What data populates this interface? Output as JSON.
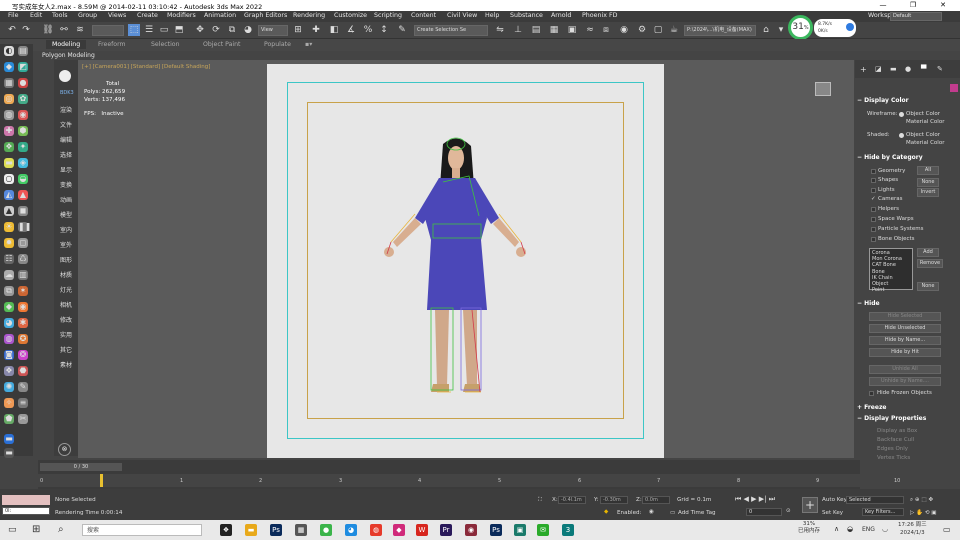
{
  "window": {
    "title": "写实成年女人2.max - 8.59M @ 2014-02-11 03:10:42 - Autodesk 3ds Max 2022",
    "min": "—",
    "max": "❐",
    "close": "✕"
  },
  "menu": [
    "File",
    "Edit",
    "Tools",
    "Group",
    "Views",
    "Create",
    "Modifiers",
    "Animation",
    "Graph Editors",
    "Rendering",
    "Customize",
    "Scripting",
    "Content",
    "Civil View",
    "Help",
    "Substance",
    "Arnold",
    "Phoenix FD"
  ],
  "workspace": {
    "label": "Workspaces:",
    "value": "Default"
  },
  "toolbar": {
    "view_dropdown": "View",
    "selection_set": "Create Selection Se",
    "project_path": "P:\\2024\\...\\机电_设备(MAX)",
    "memory_percent": "31",
    "memory_unit": "%",
    "net_up": "8.7K/s",
    "net_down": "0K/s"
  },
  "ribbon": {
    "tabs": [
      "Modeling",
      "Freeform",
      "Selection",
      "Object Paint",
      "Populate"
    ],
    "active": "Modeling",
    "sub": "Polygon Modeling"
  },
  "cn_panel": [
    "BDK3",
    "渲染",
    "文件",
    "编辑",
    "选择",
    "显示",
    "变换",
    "动画",
    "模型",
    "室内",
    "室外",
    "图形",
    "材质",
    "灯光",
    "相机",
    "修改",
    "实用",
    "其它",
    "素材"
  ],
  "viewport": {
    "label_parts": [
      "[+]",
      "[Camera001]",
      "[Standard]",
      "[Default Shading]"
    ],
    "stats": {
      "total": "Total",
      "polys_label": "Polys:",
      "polys": "262,659",
      "verts_label": "Verts:",
      "verts": "137,496",
      "fps_label": "FPS:",
      "fps": "Inactive"
    }
  },
  "right_panel": {
    "display_color": {
      "title": "Display Color",
      "wireframe": "Wireframe:",
      "shaded": "Shaded:",
      "object_color": "Object Color",
      "material_color": "Material Color"
    },
    "hide_by_category": {
      "title": "Hide by Category",
      "items": [
        "Geometry",
        "Shapes",
        "Lights",
        "Cameras",
        "Helpers",
        "Space Warps",
        "Particle Systems",
        "Bone Objects"
      ],
      "buttons": [
        "All",
        "None",
        "Invert"
      ],
      "list": [
        "Corona",
        "Mon Corona",
        "CAT Bone",
        "Bone",
        "IK Chain Object",
        "Point"
      ],
      "list_buttons": [
        "Add",
        "Remove",
        "None"
      ]
    },
    "hide": {
      "title": "Hide",
      "buttons": [
        "Hide Selected",
        "Hide Unselected",
        "Hide by Name...",
        "Hide by Hit",
        "Unhide All",
        "Unhide by Name...."
      ],
      "frozen": "Hide Frozen Objects"
    },
    "freeze": {
      "title": "Freeze"
    },
    "display_props": {
      "title": "Display Properties",
      "items": [
        "Display as Box",
        "Backface Cull",
        "Edges Only",
        "Vertex Ticks"
      ]
    }
  },
  "timeline": {
    "frame": "0 / 30",
    "ticks": [
      "0",
      "1",
      "2",
      "3",
      "4",
      "5",
      "6",
      "7",
      "8",
      "9",
      "10"
    ]
  },
  "status": {
    "swatch": "",
    "input": "0l:",
    "none_selected": "None Selected",
    "render_time": "Rendering Time  0:00:14",
    "x_label": "X:",
    "x_val": "-0.4l.1m",
    "y_label": "Y:",
    "y_val": "-0.30m",
    "z_label": "Z:",
    "z_val": "0.0m",
    "grid": "Grid = 0.1m",
    "enabled": "Enabled:",
    "add_time_tag": "Add Time Tag",
    "auto_key": "Auto Key",
    "selected": "Selected",
    "set_key": "Set Key",
    "key_filters": "Key Filters...",
    "frame_val": "0"
  },
  "taskbar": {
    "search": "搜索",
    "mem_percent": "31%",
    "mem_label": "已用内存",
    "lang": "ENG",
    "time": "17:26 周三",
    "date": "2024/1/3"
  }
}
